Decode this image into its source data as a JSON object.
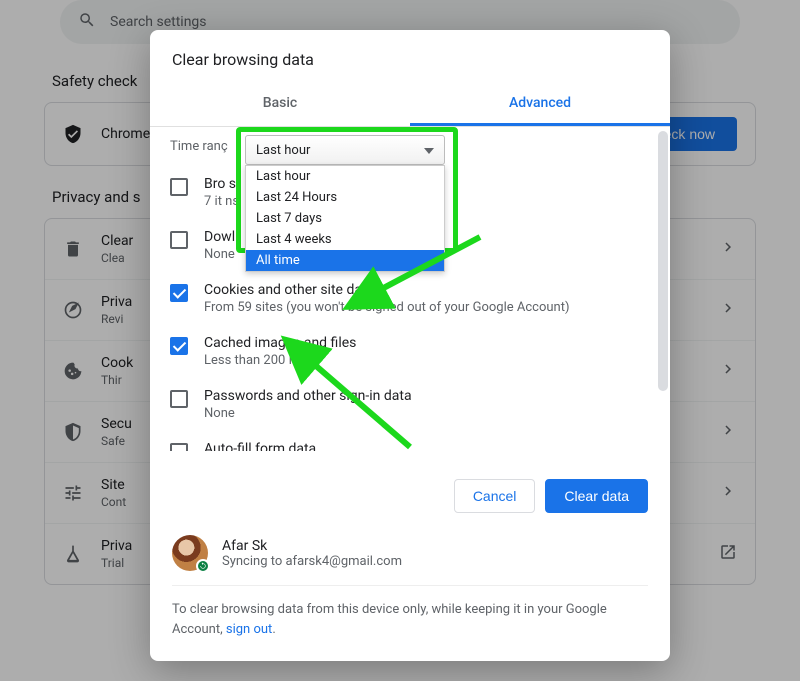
{
  "search": {
    "placeholder": "Search settings"
  },
  "sections": {
    "safety": {
      "title": "Safety check",
      "row": {
        "title": "Chrome",
        "button": "eck now"
      }
    },
    "privacy": {
      "title": "Privacy and s",
      "items": [
        {
          "title": "Clear",
          "sub": "Clea"
        },
        {
          "title": "Priva",
          "sub": "Revi"
        },
        {
          "title": "Cook",
          "sub": "Thir"
        },
        {
          "title": "Secu",
          "sub": "Safe"
        },
        {
          "title": "Site",
          "sub": "Cont"
        },
        {
          "title": "Priva",
          "sub": "Trial"
        }
      ]
    }
  },
  "dialog": {
    "title": "Clear browsing data",
    "tabs": {
      "basic": "Basic",
      "advanced": "Advanced"
    },
    "time_label": "Time ranç",
    "select": {
      "value": "Last hour",
      "options": [
        "Last hour",
        "Last 24 Hours",
        "Last 7 days",
        "Last 4 weeks",
        "All time"
      ],
      "highlight_index": 4
    },
    "items": [
      {
        "title": "Bro si",
        "sub": "7 it ns",
        "checked": false
      },
      {
        "title": "Dowl",
        "sub": "None",
        "checked": false
      },
      {
        "title": "Cookies and other site data",
        "sub": "From 59 sites (you won't be signed out of your Google Account)",
        "checked": true
      },
      {
        "title": "Cached images and files",
        "sub": "Less than 200 MB",
        "checked": true
      },
      {
        "title": "Passwords and other sign-in data",
        "sub": "None",
        "checked": false
      },
      {
        "title": "Auto-fill form data",
        "sub": "",
        "checked": false
      }
    ],
    "buttons": {
      "cancel": "Cancel",
      "clear": "Clear data"
    },
    "profile": {
      "name": "Afar Sk",
      "syncing_prefix": "Syncing to ",
      "email": "afarsk4@gmail.com"
    },
    "footer": {
      "text": "To clear browsing data from this device only, while keeping it in your Google Account, ",
      "link": "sign out"
    }
  }
}
